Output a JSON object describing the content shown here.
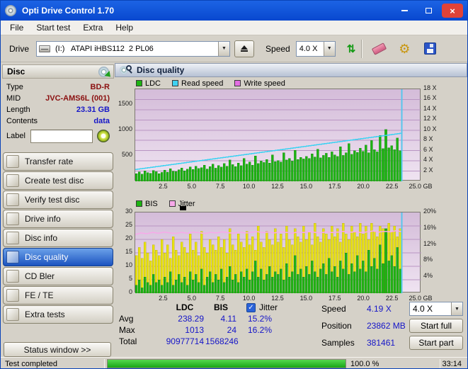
{
  "window": {
    "title": "Opti Drive Control 1.70"
  },
  "menu": {
    "items": [
      "File",
      "Start test",
      "Extra",
      "Help"
    ]
  },
  "toolbar": {
    "drive_label": "Drive",
    "drive_value": "(I:)   ATAPI iHBS112  2 PL06",
    "speed_label": "Speed",
    "speed_value": "4.0 X",
    "icon_glyphs": {
      "gear": "⚙",
      "speed_check": "⇅"
    }
  },
  "sidebar": {
    "section_title": "Disc",
    "info": [
      {
        "label": "Type",
        "value": "BD-R",
        "color": "#8b1010"
      },
      {
        "label": "MID",
        "value": "JVC-AMS6L (001)",
        "color": "#8b1010"
      },
      {
        "label": "Length",
        "value": "23.31 GB",
        "color": "#1515c8"
      },
      {
        "label": "Contents",
        "value": "data",
        "color": "#1515c8"
      }
    ],
    "label_field": {
      "label": "Label",
      "value": ""
    },
    "nav": [
      {
        "label": "Transfer rate",
        "active": false
      },
      {
        "label": "Create test disc",
        "active": false
      },
      {
        "label": "Verify test disc",
        "active": false
      },
      {
        "label": "Drive info",
        "active": false
      },
      {
        "label": "Disc info",
        "active": false
      },
      {
        "label": "Disc quality",
        "active": true
      },
      {
        "label": "CD Bler",
        "active": false
      },
      {
        "label": "FE / TE",
        "active": false
      },
      {
        "label": "Extra tests",
        "active": false
      }
    ],
    "status_window_label": "Status window >>"
  },
  "main": {
    "header": "Disc quality"
  },
  "stats": {
    "columns": [
      "LDC",
      "BIS"
    ],
    "jitter_label": "Jitter",
    "jitter_checked": true,
    "rows": [
      {
        "label": "Avg",
        "ldc": "238.29",
        "bis": "4.11",
        "jitter": "15.2%"
      },
      {
        "label": "Max",
        "ldc": "1013",
        "bis": "24",
        "jitter": "16.2%"
      },
      {
        "label": "Total",
        "ldc": "90977714",
        "bis": "1568246",
        "jitter": ""
      }
    ],
    "speed_label": "Speed",
    "speed_value": "4.19 X",
    "speed_select": "4.0 X",
    "position_label": "Position",
    "position_value": "23862 MB",
    "samples_label": "Samples",
    "samples_value": "381461",
    "start_full_label": "Start full",
    "start_part_label": "Start part"
  },
  "statusbar": {
    "text": "Test completed",
    "percent_label": "100.0 %",
    "progress_percent": 100,
    "time": "33:14"
  },
  "chart_data": [
    {
      "type": "bar",
      "title": "LDC errors and speed vs disc position",
      "legend": [
        {
          "label": "LDC",
          "color": "#1db312"
        },
        {
          "label": "Read speed",
          "color": "#3ed2f2"
        },
        {
          "label": "Write speed",
          "color": "#e26ee2"
        }
      ],
      "x_max_gb": 25.0,
      "data_end_gb": 23.3,
      "x_ticks": [
        2.5,
        5.0,
        7.5,
        10.0,
        12.5,
        15.0,
        17.5,
        20.0,
        22.5,
        25.0
      ],
      "x_unit": "GB",
      "left_axis": {
        "ticks": [
          500,
          1000,
          1500
        ],
        "max": 1800
      },
      "right_axis": {
        "ticks": [
          2,
          4,
          6,
          8,
          10,
          12,
          14,
          16,
          18
        ],
        "unit": "X",
        "scale": 100
      },
      "ldc_bars": [
        150,
        185,
        140,
        205,
        170,
        158,
        212,
        188,
        152,
        176,
        222,
        178,
        248,
        198,
        192,
        228,
        262,
        208,
        238,
        282,
        232,
        298,
        252,
        268,
        318,
        242,
        288,
        338,
        258,
        312,
        278,
        348,
        298,
        418,
        328,
        288,
        358,
        308,
        448,
        338,
        378,
        318,
        498,
        348,
        398,
        368,
        428,
        358,
        518,
        388,
        408,
        378,
        558,
        418,
        448,
        398,
        608,
        428,
        468,
        438,
        488,
        448,
        538,
        478,
        628,
        458,
        508,
        548,
        468,
        578,
        518,
        488,
        678,
        508,
        558,
        738,
        528,
        598,
        568,
        648,
        588,
        708,
        558,
        798,
        618,
        578,
        898,
        638,
        1013,
        658,
        698,
        618,
        848,
        598
      ],
      "read_speed_line": {
        "start_gb": 0,
        "start_x_speed": 2.3,
        "end_gb": 23.3,
        "end_x_speed": 9.4
      }
    },
    {
      "type": "bar",
      "title": "BIS errors and jitter vs disc position",
      "legend": [
        {
          "label": "BIS",
          "color": "#1db312"
        },
        {
          "label": "Jitter",
          "color": "#f7a9e9"
        }
      ],
      "x_max_gb": 25.0,
      "data_end_gb": 23.3,
      "x_ticks": [
        2.5,
        5.0,
        7.5,
        10.0,
        12.5,
        15.0,
        17.5,
        20.0,
        22.5,
        25.0
      ],
      "x_unit": "GB",
      "left_axis": {
        "ticks": [
          0,
          5,
          10,
          15,
          20,
          25,
          30
        ],
        "max": 30
      },
      "right_axis": {
        "ticks": [
          4,
          8,
          12,
          16,
          20
        ],
        "unit": "%",
        "left_per_unit": 1.5
      },
      "jitter_bars": [
        14,
        17,
        13,
        19,
        15,
        12,
        18,
        16,
        14,
        20,
        15,
        18,
        13,
        21,
        16,
        14,
        19,
        17,
        15,
        22,
        16,
        19,
        14,
        23,
        17,
        15,
        20,
        18,
        16,
        21,
        17,
        20,
        15,
        24,
        18,
        16,
        22,
        19,
        17,
        23,
        18,
        21,
        16,
        25,
        19,
        17,
        23,
        20,
        18,
        24,
        19,
        22,
        17,
        25,
        20,
        18,
        24,
        21,
        19,
        25,
        20,
        23,
        18,
        26,
        21,
        19,
        24,
        22,
        20,
        25,
        21,
        24,
        19,
        26,
        22,
        20,
        25,
        23,
        21,
        26,
        22,
        25,
        20,
        26,
        23,
        21,
        25,
        24,
        22,
        26,
        23,
        25,
        21,
        24
      ],
      "bis_bars": [
        3,
        5,
        2,
        6,
        4,
        3,
        7,
        4,
        5,
        3,
        6,
        4,
        8,
        3,
        5,
        7,
        4,
        6,
        3,
        8,
        5,
        7,
        4,
        9,
        3,
        6,
        8,
        4,
        7,
        5,
        9,
        4,
        6,
        10,
        5,
        7,
        4,
        8,
        6,
        9,
        5,
        8,
        12,
        6,
        9,
        5,
        7,
        10,
        6,
        8,
        7,
        9,
        5,
        11,
        6,
        8,
        14,
        7,
        9,
        6,
        10,
        7,
        12,
        8,
        6,
        9,
        11,
        7,
        13,
        8,
        10,
        6,
        12,
        9,
        15,
        7,
        11,
        8,
        14,
        9,
        12,
        8,
        16,
        10,
        13,
        9,
        18,
        11,
        24,
        12,
        14,
        10,
        17,
        9
      ],
      "jitter_line": [
        21.8,
        22.4,
        22.1,
        22.6,
        22.3,
        22.7,
        22.4,
        22.2,
        22.6,
        22.3,
        22.7,
        22.5,
        22.2,
        22.6,
        22.4,
        22.8,
        22.5,
        22.3,
        22.7,
        22.4,
        22.6,
        22.9,
        22.5,
        22.7,
        22.4,
        22.8,
        22.6,
        22.3,
        22.7,
        22.5,
        22.9,
        22.6,
        22.4,
        22.8,
        22.5,
        22.7,
        23.0,
        22.6,
        22.9,
        22.5,
        22.8,
        23.1,
        22.7,
        23.0,
        22.8,
        23.2,
        22.9
      ]
    }
  ]
}
